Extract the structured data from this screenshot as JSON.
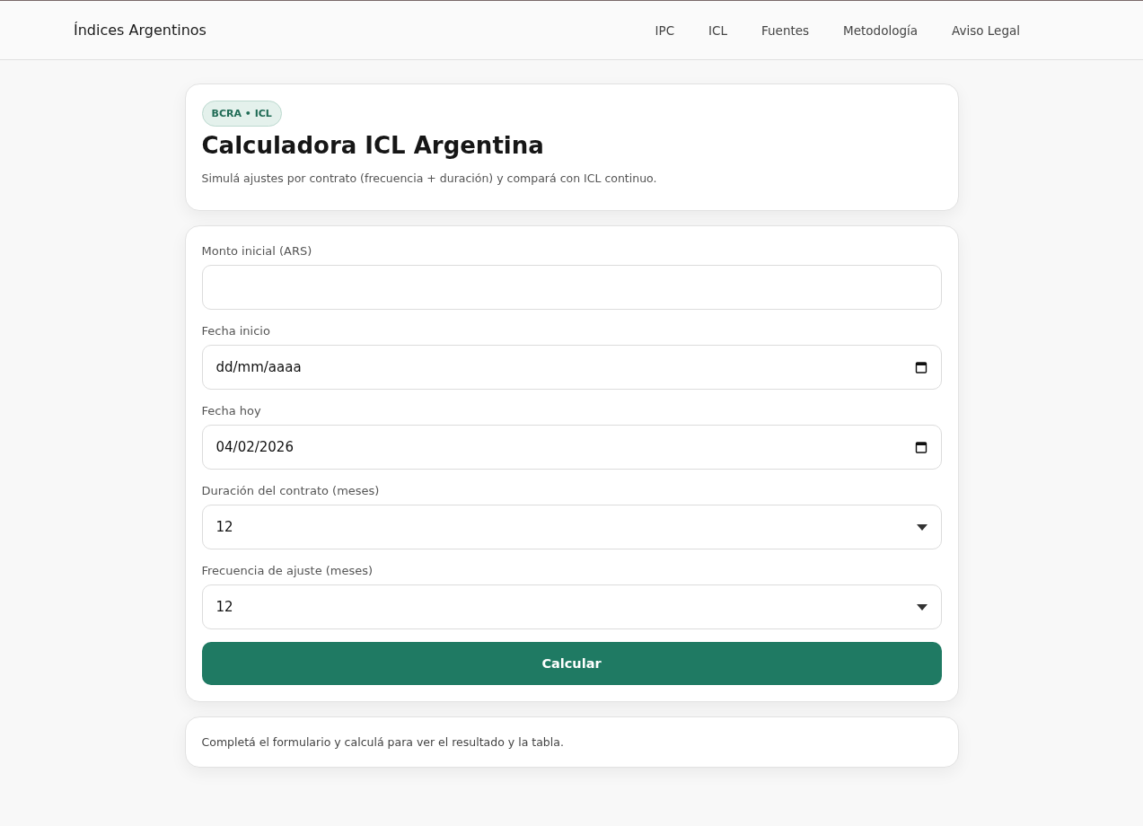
{
  "header": {
    "brand": "Índices Argentinos",
    "nav": [
      {
        "label": "IPC"
      },
      {
        "label": "ICL"
      },
      {
        "label": "Fuentes"
      },
      {
        "label": "Metodología"
      },
      {
        "label": "Aviso Legal"
      }
    ]
  },
  "hero": {
    "badge": "BCRA • ICL",
    "title": "Calculadora ICL Argentina",
    "subtitle": "Simulá ajustes por contrato (frecuencia + duración) y compará con ICL continuo."
  },
  "form": {
    "fields": [
      {
        "kind": "text",
        "label": "Monto inicial (ARS)"
      },
      {
        "kind": "date",
        "label": "Fecha inicio",
        "placeholder": "dd/mm/aaaa"
      },
      {
        "kind": "date",
        "label": "Fecha hoy",
        "value": "04/02/2026"
      },
      {
        "kind": "select",
        "label": "Duración del contrato (meses)",
        "value": "12"
      },
      {
        "kind": "select",
        "label": "Frecuencia de ajuste (meses)",
        "value": "12"
      }
    ],
    "submit": "Calcular"
  },
  "result": {
    "message": "Completá el formulario y calculá para ver el resultado y la tabla."
  }
}
